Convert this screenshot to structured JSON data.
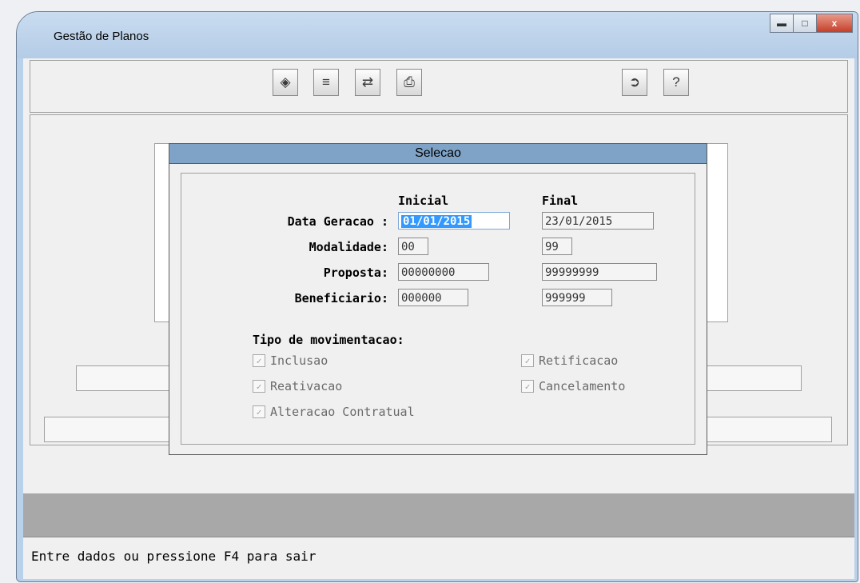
{
  "window": {
    "title": "Gestão de Planos",
    "minimize_icon": "minimize-icon",
    "maximize_icon": "maximize-icon",
    "close_label": "x"
  },
  "toolbar": {
    "left_icons": [
      "eraser-icon",
      "sort-az-icon",
      "list-import-icon",
      "printer-icon"
    ],
    "right_icons": [
      "exit-door-icon",
      "help-icon"
    ]
  },
  "dialog": {
    "title": "Selecao",
    "col_initial": "Inicial",
    "col_final": "Final",
    "rows": [
      {
        "label": "Data Geracao :",
        "initial": "01/01/2015",
        "final": "23/01/2015"
      },
      {
        "label": "Modalidade:",
        "initial": "00",
        "final": "99"
      },
      {
        "label": "Proposta:",
        "initial": "00000000",
        "final": "99999999"
      },
      {
        "label": "Beneficiario:",
        "initial": "000000",
        "final": "999999"
      }
    ],
    "tipo_label": "Tipo de movimentacao:",
    "checks": [
      {
        "label": "Inclusao",
        "checked": true
      },
      {
        "label": "Retificacao",
        "checked": true
      },
      {
        "label": "Reativacao",
        "checked": true
      },
      {
        "label": "Cancelamento",
        "checked": true
      },
      {
        "label": "Alteracao Contratual",
        "checked": true
      }
    ]
  },
  "status": {
    "message": "Entre dados ou pressione F4 para sair"
  }
}
